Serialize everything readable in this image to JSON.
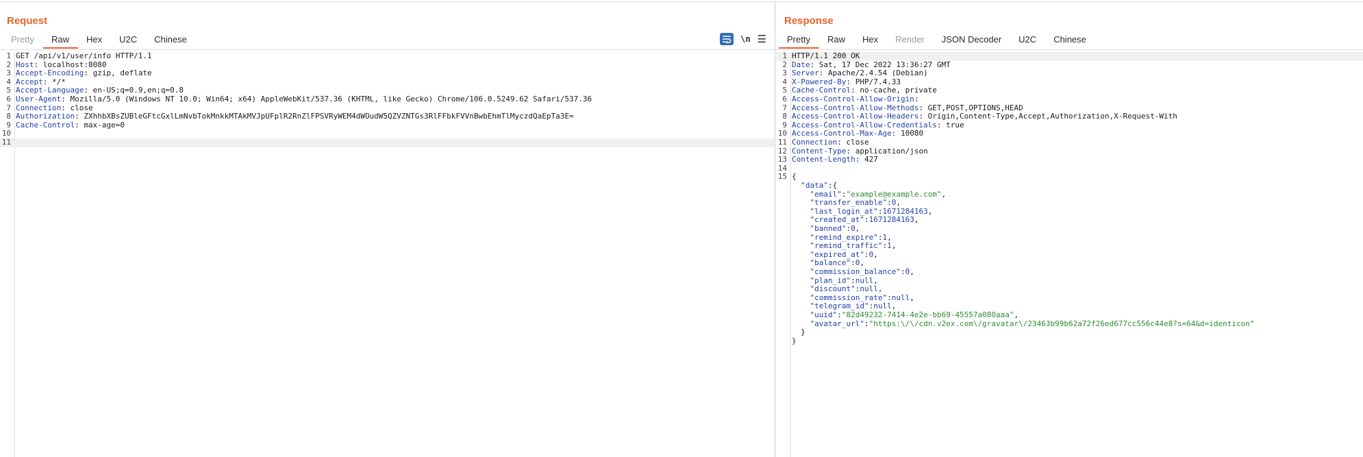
{
  "request": {
    "title": "Request",
    "tabs": [
      {
        "label": "Pretty",
        "state": "disabled"
      },
      {
        "label": "Raw",
        "state": "active"
      },
      {
        "label": "Hex",
        "state": "normal"
      },
      {
        "label": "U2C",
        "state": "normal"
      },
      {
        "label": "Chinese",
        "state": "normal"
      }
    ],
    "tools": {
      "wrap_icon": "word-wrap-icon",
      "newline_label": "\\n",
      "menu_icon": "hamburger-menu-icon"
    },
    "lines": [
      {
        "num": "1",
        "parts": [
          {
            "t": "GET /api/v1/user/info HTTP/1.1"
          }
        ]
      },
      {
        "num": "2",
        "parts": [
          {
            "t": "Host",
            "c": "key"
          },
          {
            "t": ": localhost:8080"
          }
        ]
      },
      {
        "num": "3",
        "parts": [
          {
            "t": "Accept-Encoding",
            "c": "key"
          },
          {
            "t": ": gzip, deflate"
          }
        ]
      },
      {
        "num": "4",
        "parts": [
          {
            "t": "Accept",
            "c": "key"
          },
          {
            "t": ": */*"
          }
        ]
      },
      {
        "num": "5",
        "parts": [
          {
            "t": "Accept-Language",
            "c": "key"
          },
          {
            "t": ": en-US;q=0.9,en;q=0.8"
          }
        ]
      },
      {
        "num": "6",
        "parts": [
          {
            "t": "User-Agent",
            "c": "key"
          },
          {
            "t": ": Mozilla/5.0 (Windows NT 10.0; Win64; x64) AppleWebKit/537.36 (KHTML, like Gecko) Chrome/106.0.5249.62 Safari/537.36"
          }
        ]
      },
      {
        "num": "7",
        "parts": [
          {
            "t": "Connection",
            "c": "key"
          },
          {
            "t": ": close"
          }
        ]
      },
      {
        "num": "8",
        "parts": [
          {
            "t": "Authorization",
            "c": "key"
          },
          {
            "t": ": ZXhhbXBsZUBleGFtcGxlLmNvbTokMnkkMTAkMVJpUFplR2RnZlFPSVRyWEM4dWOudW5QZVZNTGs3RlFFbkFVVnBwbEhmTlMyczdQaEpTa3E="
          }
        ]
      },
      {
        "num": "9",
        "parts": [
          {
            "t": "Cache-Control",
            "c": "key"
          },
          {
            "t": ": max-age=0"
          }
        ]
      },
      {
        "num": "10",
        "parts": []
      },
      {
        "num": "11",
        "parts": [],
        "highlight": true
      }
    ]
  },
  "response": {
    "title": "Response",
    "tabs": [
      {
        "label": "Pretty",
        "state": "active"
      },
      {
        "label": "Raw",
        "state": "normal"
      },
      {
        "label": "Hex",
        "state": "normal"
      },
      {
        "label": "Render",
        "state": "disabled"
      },
      {
        "label": "JSON Decoder",
        "state": "normal"
      },
      {
        "label": "U2C",
        "state": "normal"
      },
      {
        "label": "Chinese",
        "state": "normal"
      }
    ],
    "lines": [
      {
        "num": "1",
        "parts": [
          {
            "t": "HTTP/1.1 200 OK"
          }
        ],
        "highlight": true
      },
      {
        "num": "2",
        "parts": [
          {
            "t": "Date",
            "c": "key"
          },
          {
            "t": ": Sat, 17 Dec 2022 13:36:27 GMT"
          }
        ]
      },
      {
        "num": "3",
        "parts": [
          {
            "t": "Server",
            "c": "key"
          },
          {
            "t": ": Apache/2.4.54 (Debian)"
          }
        ]
      },
      {
        "num": "4",
        "parts": [
          {
            "t": "X-Powered-By",
            "c": "key"
          },
          {
            "t": ": PHP/7.4.33"
          }
        ]
      },
      {
        "num": "5",
        "parts": [
          {
            "t": "Cache-Control",
            "c": "key"
          },
          {
            "t": ": no-cache, private"
          }
        ]
      },
      {
        "num": "6",
        "parts": [
          {
            "t": "Access-Control-Allow-Origin",
            "c": "key"
          },
          {
            "t": ":"
          }
        ]
      },
      {
        "num": "7",
        "parts": [
          {
            "t": "Access-Control-Allow-Methods",
            "c": "key"
          },
          {
            "t": ": GET,POST,OPTIONS,HEAD"
          }
        ]
      },
      {
        "num": "8",
        "parts": [
          {
            "t": "Access-Control-Allow-Headers",
            "c": "key"
          },
          {
            "t": ": Origin,Content-Type,Accept,Authorization,X-Request-With"
          }
        ]
      },
      {
        "num": "9",
        "parts": [
          {
            "t": "Access-Control-Allow-Credentials",
            "c": "key"
          },
          {
            "t": ": true"
          }
        ]
      },
      {
        "num": "10",
        "parts": [
          {
            "t": "Access-Control-Max-Age",
            "c": "key"
          },
          {
            "t": ": 10080"
          }
        ]
      },
      {
        "num": "11",
        "parts": [
          {
            "t": "Connection",
            "c": "key"
          },
          {
            "t": ": close"
          }
        ]
      },
      {
        "num": "12",
        "parts": [
          {
            "t": "Content-Type",
            "c": "key"
          },
          {
            "t": ": application/json"
          }
        ]
      },
      {
        "num": "13",
        "parts": [
          {
            "t": "Content-Length",
            "c": "key"
          },
          {
            "t": ": 427"
          }
        ]
      },
      {
        "num": "14",
        "parts": []
      },
      {
        "num": "15",
        "parts": [
          {
            "t": "{"
          }
        ]
      },
      {
        "num": "",
        "parts": [
          {
            "t": "  "
          },
          {
            "t": "\"data\"",
            "c": "jkey"
          },
          {
            "t": ":{"
          }
        ]
      },
      {
        "num": "",
        "parts": [
          {
            "t": "    "
          },
          {
            "t": "\"email\"",
            "c": "jkey"
          },
          {
            "t": ":"
          },
          {
            "t": "\"example@example.com\"",
            "c": "jstr"
          },
          {
            "t": ","
          }
        ]
      },
      {
        "num": "",
        "parts": [
          {
            "t": "    "
          },
          {
            "t": "\"transfer_enable\"",
            "c": "jkey"
          },
          {
            "t": ":"
          },
          {
            "t": "0",
            "c": "jnum"
          },
          {
            "t": ","
          }
        ]
      },
      {
        "num": "",
        "parts": [
          {
            "t": "    "
          },
          {
            "t": "\"last_login_at\"",
            "c": "jkey"
          },
          {
            "t": ":"
          },
          {
            "t": "1671284163",
            "c": "jnum"
          },
          {
            "t": ","
          }
        ]
      },
      {
        "num": "",
        "parts": [
          {
            "t": "    "
          },
          {
            "t": "\"created_at\"",
            "c": "jkey"
          },
          {
            "t": ":"
          },
          {
            "t": "1671284163",
            "c": "jnum"
          },
          {
            "t": ","
          }
        ]
      },
      {
        "num": "",
        "parts": [
          {
            "t": "    "
          },
          {
            "t": "\"banned\"",
            "c": "jkey"
          },
          {
            "t": ":"
          },
          {
            "t": "0",
            "c": "jnum"
          },
          {
            "t": ","
          }
        ]
      },
      {
        "num": "",
        "parts": [
          {
            "t": "    "
          },
          {
            "t": "\"remind_expire\"",
            "c": "jkey"
          },
          {
            "t": ":"
          },
          {
            "t": "1",
            "c": "jnum"
          },
          {
            "t": ","
          }
        ]
      },
      {
        "num": "",
        "parts": [
          {
            "t": "    "
          },
          {
            "t": "\"remind_traffic\"",
            "c": "jkey"
          },
          {
            "t": ":"
          },
          {
            "t": "1",
            "c": "jnum"
          },
          {
            "t": ","
          }
        ]
      },
      {
        "num": "",
        "parts": [
          {
            "t": "    "
          },
          {
            "t": "\"expired_at\"",
            "c": "jkey"
          },
          {
            "t": ":"
          },
          {
            "t": "0",
            "c": "jnum"
          },
          {
            "t": ","
          }
        ]
      },
      {
        "num": "",
        "parts": [
          {
            "t": "    "
          },
          {
            "t": "\"balance\"",
            "c": "jkey"
          },
          {
            "t": ":"
          },
          {
            "t": "0",
            "c": "jnum"
          },
          {
            "t": ","
          }
        ]
      },
      {
        "num": "",
        "parts": [
          {
            "t": "    "
          },
          {
            "t": "\"commission_balance\"",
            "c": "jkey"
          },
          {
            "t": ":"
          },
          {
            "t": "0",
            "c": "jnum"
          },
          {
            "t": ","
          }
        ]
      },
      {
        "num": "",
        "parts": [
          {
            "t": "    "
          },
          {
            "t": "\"plan_id\"",
            "c": "jkey"
          },
          {
            "t": ":"
          },
          {
            "t": "null",
            "c": "jnum"
          },
          {
            "t": ","
          }
        ]
      },
      {
        "num": "",
        "parts": [
          {
            "t": "    "
          },
          {
            "t": "\"discount\"",
            "c": "jkey"
          },
          {
            "t": ":"
          },
          {
            "t": "null",
            "c": "jnum"
          },
          {
            "t": ","
          }
        ]
      },
      {
        "num": "",
        "parts": [
          {
            "t": "    "
          },
          {
            "t": "\"commission_rate\"",
            "c": "jkey"
          },
          {
            "t": ":"
          },
          {
            "t": "null",
            "c": "jnum"
          },
          {
            "t": ","
          }
        ]
      },
      {
        "num": "",
        "parts": [
          {
            "t": "    "
          },
          {
            "t": "\"telegram_id\"",
            "c": "jkey"
          },
          {
            "t": ":"
          },
          {
            "t": "null",
            "c": "jnum"
          },
          {
            "t": ","
          }
        ]
      },
      {
        "num": "",
        "parts": [
          {
            "t": "    "
          },
          {
            "t": "\"uuid\"",
            "c": "jkey"
          },
          {
            "t": ":"
          },
          {
            "t": "\"82d49232-7414-4e2e-bb69-45557a080aaa\"",
            "c": "jstr"
          },
          {
            "t": ","
          }
        ]
      },
      {
        "num": "",
        "parts": [
          {
            "t": "    "
          },
          {
            "t": "\"avatar_url\"",
            "c": "jkey"
          },
          {
            "t": ":"
          },
          {
            "t": "\"https:\\/\\/cdn.v2ex.com\\/gravatar\\/23463b99b62a72f26ed677cc556c44e8?s=64&d=identicon\"",
            "c": "jstr"
          }
        ]
      },
      {
        "num": "",
        "parts": [
          {
            "t": "  }"
          }
        ]
      },
      {
        "num": "",
        "parts": [
          {
            "t": "}"
          }
        ]
      }
    ]
  },
  "colors": {
    "accent": "#e8622c",
    "header_key": "#1f3fa8",
    "json_string": "#2e8b2e",
    "wrap_button_bg": "#2f6db5"
  }
}
